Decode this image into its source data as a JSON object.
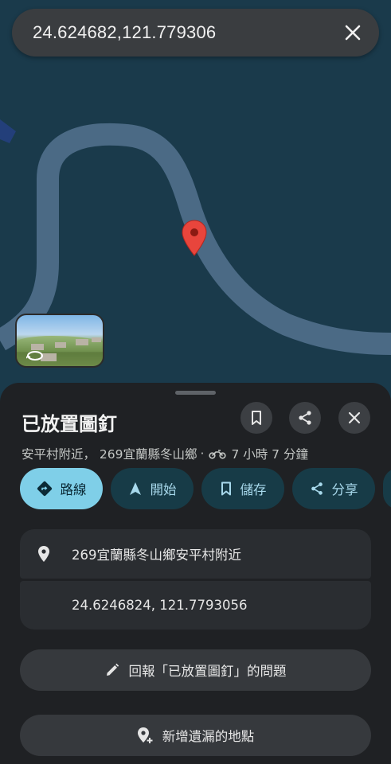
{
  "search": {
    "query": "24.624682,121.779306",
    "close_icon": "close-icon"
  },
  "map": {
    "pin_icon": "map-pin-icon",
    "street_view_icon": "street-view-icon",
    "colors": {
      "background": "#1a3a4b",
      "road": "#4b6a85",
      "pin": "#e8453c"
    }
  },
  "place": {
    "title": "已放置圖釘",
    "subtitle_location": "安平村附近， 269宜蘭縣冬山鄉",
    "subtitle_separator": "·",
    "travel_icon": "motorcycle-icon",
    "travel_time": "7 小時 7 分鐘"
  },
  "header_actions": [
    {
      "name": "bookmark-button",
      "icon": "bookmark-icon"
    },
    {
      "name": "share-button",
      "icon": "share-icon"
    },
    {
      "name": "close-sheet-button",
      "icon": "close-icon"
    }
  ],
  "chips": [
    {
      "label": "路線",
      "icon": "directions-icon"
    },
    {
      "label": "開始",
      "icon": "navigation-arrow-icon"
    },
    {
      "label": "儲存",
      "icon": "bookmark-icon"
    },
    {
      "label": "分享",
      "icon": "share-icon"
    }
  ],
  "details": {
    "address": "269宜蘭縣冬山鄉安平村附近",
    "address_icon": "location-pin-icon",
    "coordinates": "24.6246824, 121.7793056"
  },
  "actions": {
    "report_label": "回報「已放置圖釘」的問題",
    "report_icon": "edit-pencil-icon",
    "add_place_label": "新增遺漏的地點",
    "add_place_icon": "add-location-icon"
  },
  "colors": {
    "sheet": "#1f2124",
    "chip": "#173b47",
    "chip_primary": "#7fcfe8",
    "chip_text": "#a8d9ec"
  }
}
